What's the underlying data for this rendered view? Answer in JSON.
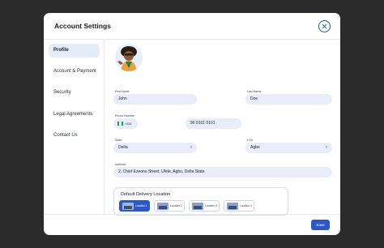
{
  "header": {
    "title": "Account Settings",
    "close_icon": "close-icon"
  },
  "sidebar": {
    "items": [
      {
        "label": "Profile",
        "active": true
      },
      {
        "label": "Account & Payment",
        "active": false
      },
      {
        "label": "Security",
        "active": false
      },
      {
        "label": "Legal Agreements",
        "active": false
      },
      {
        "label": "Contact Us",
        "active": false
      }
    ]
  },
  "profile": {
    "first_name": {
      "label": "First Name",
      "value": "John"
    },
    "last_name": {
      "label": "Last Name",
      "value": "Doe"
    },
    "phone": {
      "label": "Phone Number",
      "country_code": "+234",
      "value": "90 0101 0101"
    },
    "state": {
      "label": "State",
      "value": "Delta"
    },
    "lga": {
      "label": "LGA",
      "value": "Agbo"
    },
    "address": {
      "label": "Address",
      "value": "2, Chief Ezeonu Street, Ufele, Agbo, Delta State"
    }
  },
  "delivery": {
    "title": "Default Delivery Location",
    "locations": [
      {
        "label": "Location 1",
        "selected": true
      },
      {
        "label": "Location 2",
        "selected": false
      },
      {
        "label": "Location 3",
        "selected": false
      },
      {
        "label": "Location 4",
        "selected": false
      }
    ]
  },
  "footer": {
    "save_label": "Save"
  },
  "colors": {
    "accent": "#2a58c7",
    "field_bg": "#e8edf9",
    "backdrop": "#2b2b2b",
    "flag_green": "#1a9f4c"
  }
}
